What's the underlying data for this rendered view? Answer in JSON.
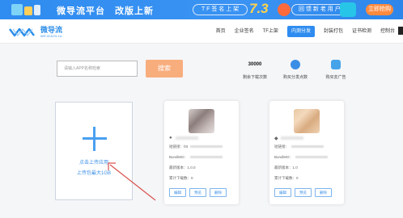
{
  "banner": {
    "title": "微导流平台",
    "headline": "改版上新",
    "pill": "T F 签 名 上 架",
    "date": "7.3",
    "pill2": "回 馈 新 老 用 户",
    "cta": "立即抢购",
    "colors": {
      "background": "#2f8cf0",
      "date": "#ffd34d",
      "cta": "#ff8a3d"
    }
  },
  "header": {
    "brand_cn": "微导流",
    "brand_en": "WEIDAOLIU",
    "nav": [
      {
        "label": "首页",
        "active": false
      },
      {
        "label": "企业签名",
        "active": false
      },
      {
        "label": "TF上架",
        "active": false
      },
      {
        "label": "内测分发",
        "active": true
      },
      {
        "label": "封装打包",
        "active": false
      },
      {
        "label": "证书检测",
        "active": false
      },
      {
        "label": "控制台",
        "active": false
      }
    ]
  },
  "search": {
    "placeholder": "请输入APP名称检索",
    "button": "搜索"
  },
  "stats": {
    "downloads_value": "30000",
    "downloads_label": "剩余下载次数",
    "distribute_icon": "money-bag-icon",
    "distribute_label": "购买分发点数",
    "ads_icon": "ad-icon",
    "ads_label": "购买去广告"
  },
  "upload": {
    "label": "点击上传应用",
    "sub": "上传包最大1GB"
  },
  "cards": [
    {
      "platform_icon": "apple-icon",
      "link_label": "短链接：",
      "link_value": "htt",
      "bundle_label": "BundleID：",
      "version_label": "最新版本：",
      "version_value": "1.0.0",
      "downloads_label": "累计下载数：",
      "downloads_value": "0",
      "buttons": [
        "编辑",
        "预览",
        "删除"
      ]
    },
    {
      "platform_icon": "android-icon",
      "link_label": "短链接：",
      "link_value": "",
      "bundle_label": "BundleID：",
      "version_label": "最新版本：",
      "version_value": "1.0",
      "downloads_label": "累计下载数：",
      "downloads_value": "0",
      "buttons": [
        "编辑",
        "预览",
        "删除"
      ]
    }
  ]
}
